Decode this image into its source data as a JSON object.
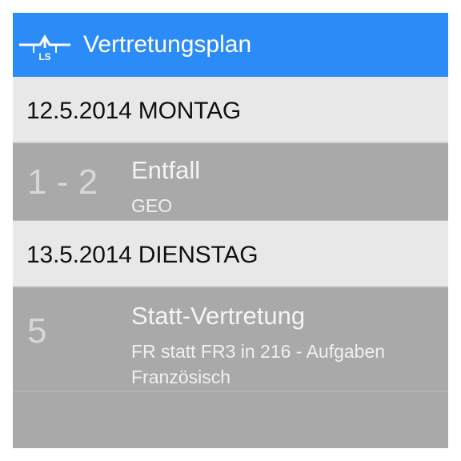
{
  "appbar": {
    "logo_text": "LS",
    "title": "Vertretungsplan",
    "color": "#2b8cf7"
  },
  "days": [
    {
      "date_label": "12.5.2014 MONTAG",
      "entries": [
        {
          "hours": "1 - 2",
          "type": "Entfall",
          "detail": "GEO"
        }
      ]
    },
    {
      "date_label": "13.5.2014 DIENSTAG",
      "entries": [
        {
          "hours": "5",
          "type": "Statt-Vertretung",
          "detail": "FR statt FR3 in 216 - Aufgaben Französisch"
        }
      ]
    }
  ]
}
